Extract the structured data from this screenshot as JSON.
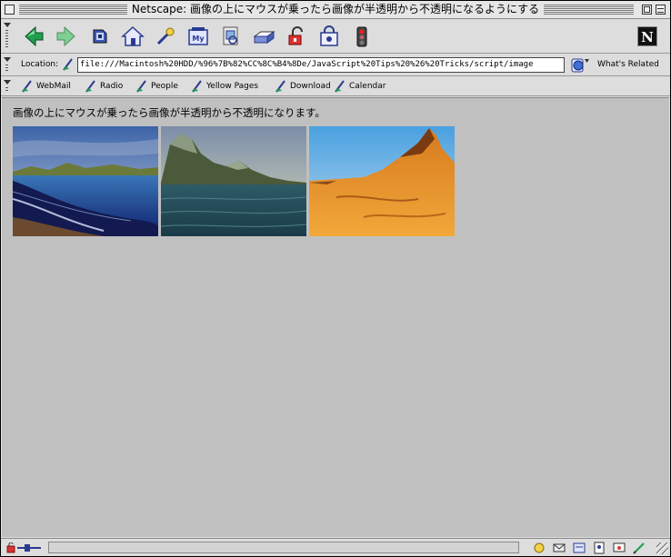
{
  "window": {
    "title": "Netscape: 画像の上にマウスが乗ったら画像が半透明から不透明になるようにする"
  },
  "toolbar": {
    "buttons": [
      {
        "name": "back-button",
        "icon": "back-arrow-icon"
      },
      {
        "name": "forward-button",
        "icon": "forward-arrow-icon"
      },
      {
        "name": "reload-button",
        "icon": "reload-icon"
      },
      {
        "name": "home-button",
        "icon": "home-icon"
      },
      {
        "name": "search-button",
        "icon": "search-icon"
      },
      {
        "name": "my-netscape-button",
        "icon": "my-netscape-icon"
      },
      {
        "name": "images-button",
        "icon": "images-icon"
      },
      {
        "name": "print-button",
        "icon": "print-icon"
      },
      {
        "name": "security-button",
        "icon": "lock-icon"
      },
      {
        "name": "shop-button",
        "icon": "shop-icon"
      },
      {
        "name": "stop-button",
        "icon": "stop-icon"
      }
    ]
  },
  "location": {
    "label": "Location:",
    "url": "file:///Macintosh%20HDD/%96%7B%82%CC%8C%B4%8De/JavaScript%20Tips%20%26%20Tricks/script/image",
    "related_label": "What's Related"
  },
  "personal_toolbar": {
    "items": [
      {
        "label": "WebMail"
      },
      {
        "label": "Radio"
      },
      {
        "label": "People"
      },
      {
        "label": "Yellow Pages"
      },
      {
        "label": "Download"
      },
      {
        "label": "Calendar"
      }
    ]
  },
  "page": {
    "heading": "画像の上にマウスが乗ったら画像が半透明から不透明になります。",
    "images": [
      {
        "name": "beach-landscape-image"
      },
      {
        "name": "lake-mountain-image"
      },
      {
        "name": "desert-mountain-image"
      }
    ]
  },
  "colors": {
    "content_background": "#c0c0c0",
    "chrome_background": "#dddddd"
  }
}
